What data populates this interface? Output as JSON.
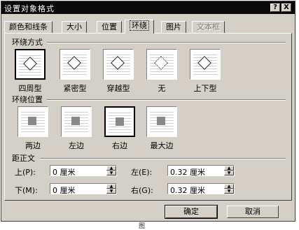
{
  "dialog": {
    "title": "设置对象格式",
    "help_label": "?",
    "close_label": "X"
  },
  "tabs": [
    {
      "label": "颜色和线条"
    },
    {
      "label": "大小"
    },
    {
      "label": "位置"
    },
    {
      "label": "环绕"
    },
    {
      "label": "图片"
    },
    {
      "label": "文本框"
    }
  ],
  "wrap_style": {
    "title": "环绕方式",
    "options": [
      {
        "label": "四周型",
        "icon": "square-wrap-icon"
      },
      {
        "label": "紧密型",
        "icon": "tight-wrap-icon"
      },
      {
        "label": "穿越型",
        "icon": "through-wrap-icon"
      },
      {
        "label": "无",
        "icon": "no-wrap-icon"
      },
      {
        "label": "上下型",
        "icon": "top-bottom-wrap-icon"
      }
    ],
    "selected": "四周型"
  },
  "wrap_position": {
    "title": "环绕位置",
    "options": [
      {
        "label": "两边",
        "icon": "both-sides-icon"
      },
      {
        "label": "左边",
        "icon": "left-side-icon"
      },
      {
        "label": "右边",
        "icon": "right-side-icon"
      },
      {
        "label": "最大边",
        "icon": "largest-side-icon"
      }
    ],
    "selected": "右边"
  },
  "distance": {
    "title": "距正文",
    "top": {
      "label": "上(P):",
      "value": "0 厘米"
    },
    "bottom": {
      "label": "下(M):",
      "value": "0 厘米"
    },
    "left": {
      "label": "左(E):",
      "value": "0.32 厘米"
    },
    "right": {
      "label": "右(G):",
      "value": "0.32 厘米"
    }
  },
  "buttons": {
    "ok": "确定",
    "cancel": "取消"
  },
  "caption": "图"
}
